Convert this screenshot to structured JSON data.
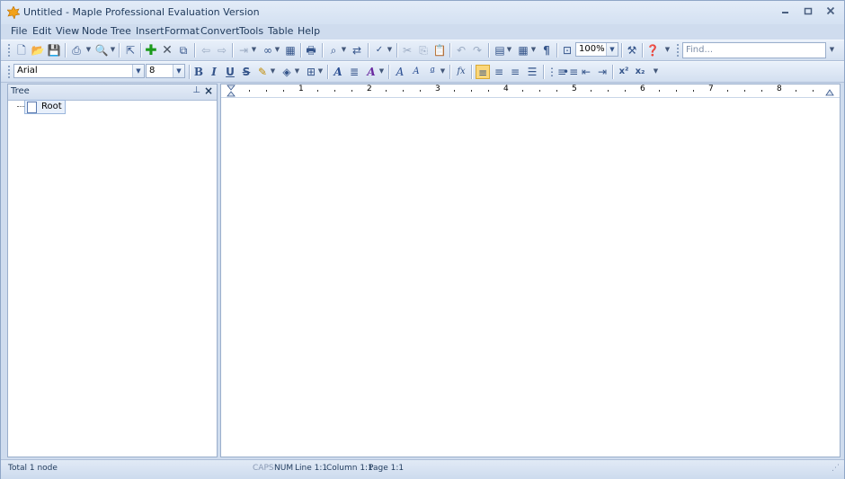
{
  "window": {
    "title": "Untitled - Maple Professional Evaluation Version",
    "controls": [
      "minimize",
      "restore",
      "close"
    ]
  },
  "menu": [
    "File",
    "Edit",
    "View",
    "Node",
    "Tree",
    "Insert",
    "Format",
    "Convert",
    "Tools",
    "Table",
    "Help"
  ],
  "toolbar1": {
    "icons": [
      "new-icon",
      "open-icon",
      "save-icon",
      "print-icon",
      "print-preview-icon",
      "export-icon",
      "add-node-icon",
      "delete-node-icon",
      "node-properties-icon",
      "move-up-icon",
      "move-down-icon",
      "indent-icon",
      "link-icon",
      "table-icon",
      "printer-icon",
      "find-icon",
      "replace-icon",
      "spellcheck-icon",
      "cut-icon",
      "copy-icon",
      "paste-icon",
      "undo-icon",
      "redo-icon",
      "page-icon",
      "insert-table-icon",
      "pilcrow-icon",
      "zoom-icon",
      "tools-icon",
      "help-icon"
    ],
    "zoom_value": "100%",
    "find_placeholder": "Find..."
  },
  "toolbar2": {
    "font_name": "Arial",
    "font_size": "8",
    "format_buttons": [
      "bold",
      "italic",
      "underline",
      "strikethrough",
      "highlight",
      "font-color",
      "borders",
      "style",
      "paragraph",
      "text-effect",
      "font-grow",
      "font-shrink",
      "case",
      "function",
      "align-left",
      "align-center",
      "align-right",
      "justify",
      "numbered-list",
      "bullet-list",
      "decrease-indent",
      "increase-indent",
      "superscript",
      "subscript"
    ]
  },
  "tree_panel": {
    "title": "Tree",
    "root_label": "Root"
  },
  "ruler_numbers": [
    "1",
    "2",
    "3",
    "4",
    "5",
    "6",
    "7",
    "8"
  ],
  "status": {
    "left": "Total 1 node",
    "caps": "CAPS",
    "num": "NUM",
    "line": "Line 1:1",
    "column": "Column 1:1",
    "page": "Page 1:1"
  }
}
